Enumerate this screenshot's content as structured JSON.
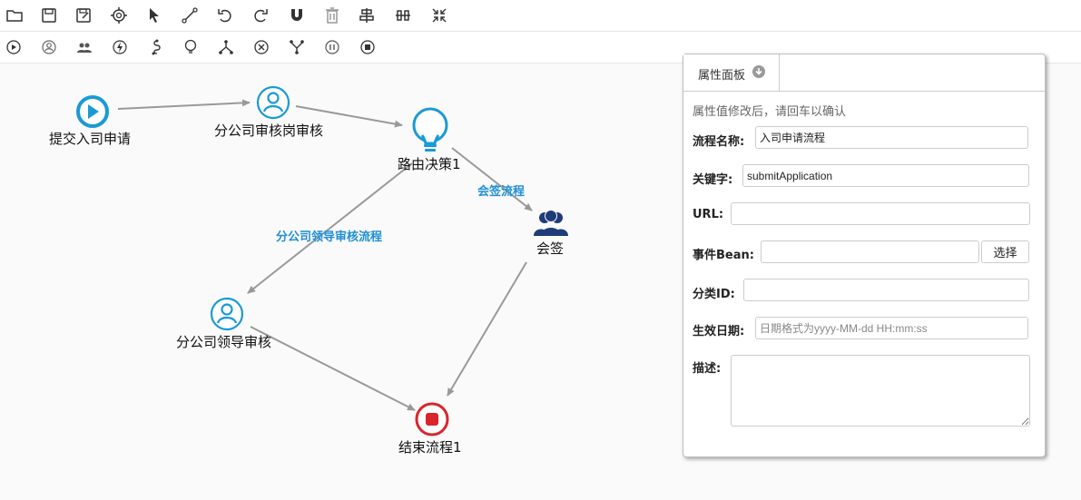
{
  "toolbar1": {
    "icons": [
      "open-folder-icon",
      "save-icon",
      "save-as-icon",
      "settings-globe-icon",
      "pointer-icon",
      "connector-icon",
      "undo-icon",
      "redo-icon",
      "magnet-icon",
      "delete-icon",
      "align-center-icon",
      "align-middle-icon",
      "collapse-icon"
    ]
  },
  "toolbar2": {
    "icons": [
      "start-node-icon",
      "user-task-icon",
      "countersign-icon",
      "auto-task-icon",
      "subprocess-icon",
      "decision-icon",
      "fork-icon",
      "join-icon",
      "merge-icon",
      "pause-icon",
      "end-node-icon"
    ]
  },
  "nodes": {
    "start": "提交入司申请",
    "branch_review": "分公司审核岗审核",
    "decision": "路由决策1",
    "countersign": "会签",
    "leader_review": "分公司领导审核",
    "end": "结束流程1"
  },
  "edges": {
    "countersign_flow": "会签流程",
    "leader_flow": "分公司领导审核流程"
  },
  "colors": {
    "accent": "#1a9ad6",
    "countersign": "#1f3b7a",
    "end": "#d9252b",
    "edge": "#999999",
    "edge_label": "#1f8fd4"
  },
  "panel": {
    "tab": "属性面板",
    "hint": "属性值修改后，请回车以确认",
    "fields": {
      "name": {
        "label": "流程名称:",
        "value": "入司申请流程"
      },
      "key": {
        "label": "关键字:",
        "value": "submitApplication"
      },
      "url": {
        "label": "URL:",
        "value": ""
      },
      "bean": {
        "label": "事件Bean:",
        "value": "",
        "button": "选择"
      },
      "category": {
        "label": "分类ID:",
        "value": ""
      },
      "date": {
        "label": "生效日期:",
        "value": "",
        "placeholder": "日期格式为yyyy-MM-dd HH:mm:ss"
      },
      "desc": {
        "label": "描述:",
        "value": ""
      }
    }
  }
}
